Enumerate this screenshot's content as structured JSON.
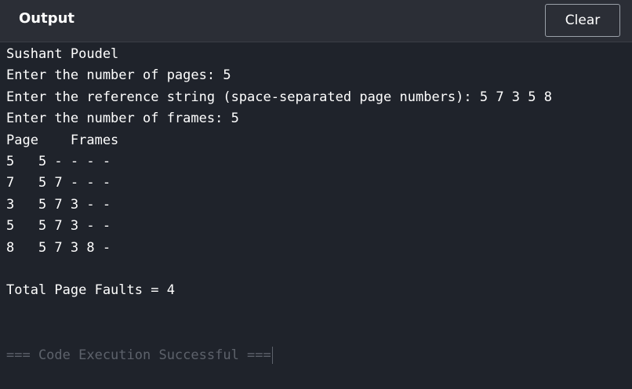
{
  "header": {
    "title": "Output",
    "clear_label": "Clear"
  },
  "output": {
    "lines": [
      "Sushant Poudel",
      "Enter the number of pages: 5",
      "Enter the reference string (space-separated page numbers): 5 7 3 5 8",
      "Enter the number of frames: 5",
      "Page    Frames",
      "5   5 - - - -",
      "7   5 7 - - -",
      "3   5 7 3 - -",
      "5   5 7 3 - -",
      "8   5 7 3 8 -",
      "",
      "Total Page Faults = 4"
    ],
    "status": "=== Code Execution Successful ==="
  },
  "colors": {
    "background": "#1f232b",
    "header": "#2b2e36",
    "text": "#ffffff",
    "muted": "#5d626b"
  }
}
